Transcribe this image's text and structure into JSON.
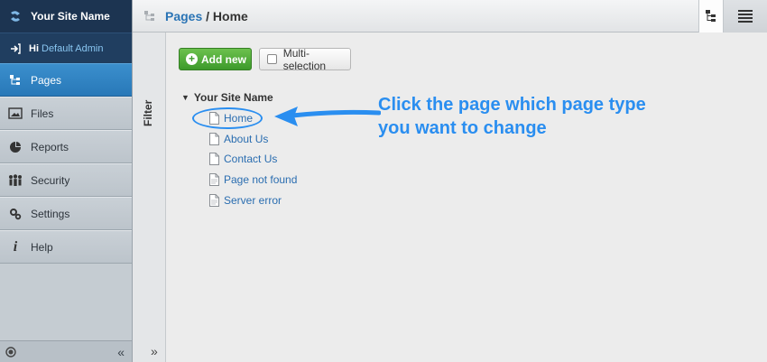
{
  "sidebar": {
    "brand": "Your Site Name",
    "user_greeting": "Hi",
    "user_name": "Default Admin",
    "items": [
      {
        "label": "Pages",
        "icon": "pages-tree-icon",
        "active": true
      },
      {
        "label": "Files",
        "icon": "image-icon",
        "active": false
      },
      {
        "label": "Reports",
        "icon": "pie-chart-icon",
        "active": false
      },
      {
        "label": "Security",
        "icon": "users-icon",
        "active": false
      },
      {
        "label": "Settings",
        "icon": "gears-icon",
        "active": false
      },
      {
        "label": "Help",
        "icon": "info-icon",
        "active": false
      }
    ],
    "collapse_glyph": "«"
  },
  "filter": {
    "label": "Filter",
    "toggle_glyph": "»"
  },
  "header": {
    "breadcrumb_link": "Pages",
    "breadcrumb_sep": " / ",
    "breadcrumb_current": "Home"
  },
  "toolbar": {
    "add_label": "Add new",
    "multi_label": "Multi-selection"
  },
  "tree": {
    "root_label": "Your Site Name",
    "items": [
      {
        "label": "Home",
        "icon": "page-icon"
      },
      {
        "label": "About Us",
        "icon": "page-icon"
      },
      {
        "label": "Contact Us",
        "icon": "page-icon"
      },
      {
        "label": "Page not found",
        "icon": "error-page-icon"
      },
      {
        "label": "Server error",
        "icon": "error-page-icon"
      }
    ]
  },
  "annotation": {
    "line1": "Click the page which page type",
    "line2": "you want to change",
    "color": "#2a8ef0"
  },
  "colors": {
    "brand_bg": "#1c3451",
    "active_nav": "#2878b8",
    "link": "#2a74b5",
    "add_button": "#3d9a2b"
  }
}
